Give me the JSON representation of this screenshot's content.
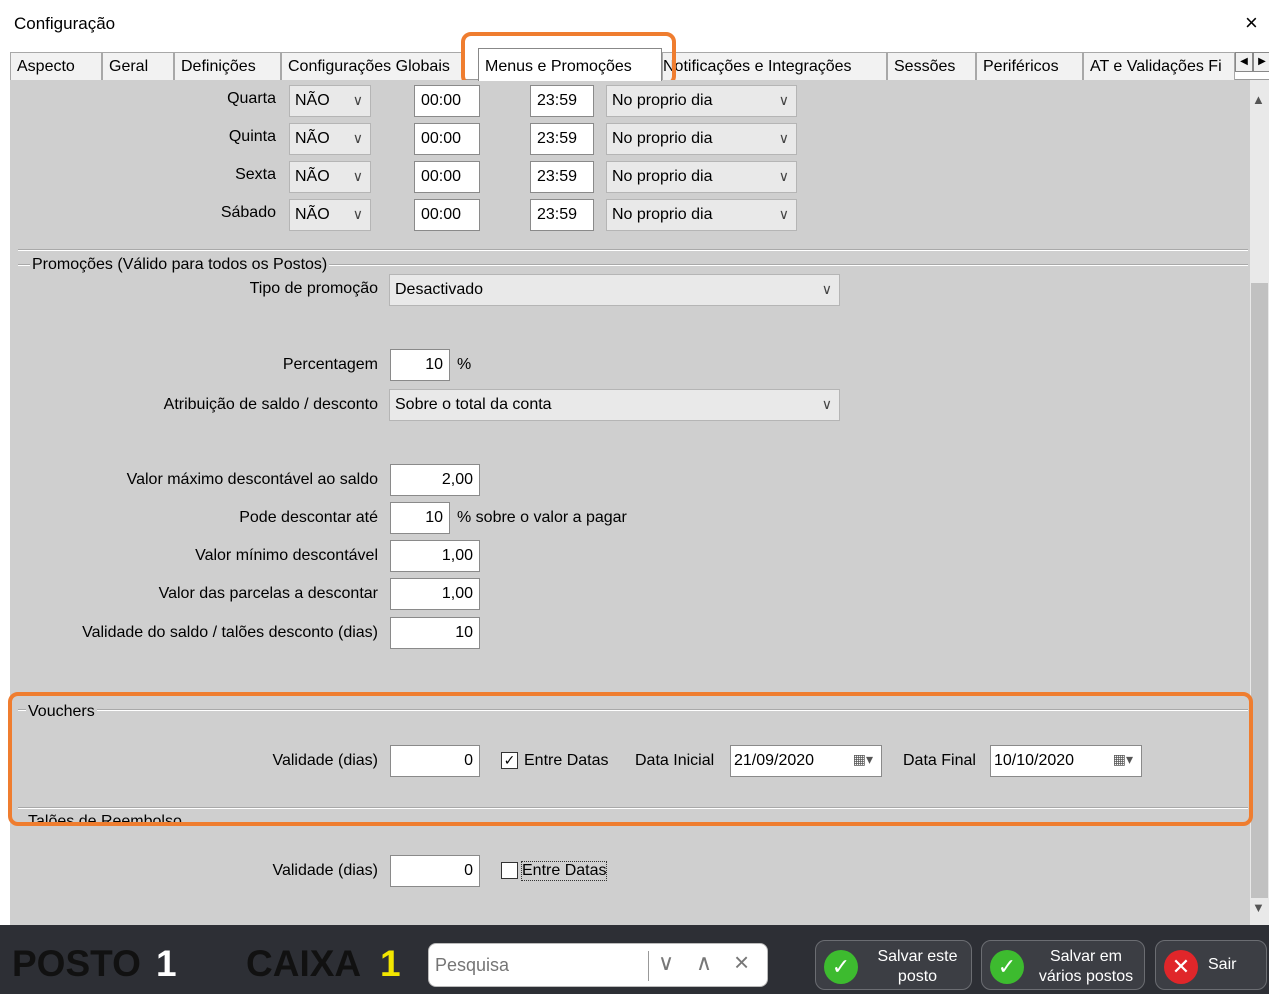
{
  "window": {
    "title": "Configuração",
    "close_glyph": "×"
  },
  "tabs": [
    {
      "label": "Aspecto"
    },
    {
      "label": "Geral"
    },
    {
      "label": "Definições"
    },
    {
      "label": "Configurações Globais"
    },
    {
      "label": "Menus e Promoções",
      "active": true
    },
    {
      "label": "Notificações e Integrações"
    },
    {
      "label": "Sessões"
    },
    {
      "label": "Periféricos"
    },
    {
      "label": "AT e Validações Fi"
    }
  ],
  "schedule": [
    {
      "day": "Quarta",
      "active": "NÃO",
      "start": "00:00",
      "end": "23:59",
      "mode": "No proprio dia"
    },
    {
      "day": "Quinta",
      "active": "NÃO",
      "start": "00:00",
      "end": "23:59",
      "mode": "No proprio dia"
    },
    {
      "day": "Sexta",
      "active": "NÃO",
      "start": "00:00",
      "end": "23:59",
      "mode": "No proprio dia"
    },
    {
      "day": "Sábado",
      "active": "NÃO",
      "start": "00:00",
      "end": "23:59",
      "mode": "No proprio dia"
    }
  ],
  "promotions": {
    "group_title": "Promoções (Válido para todos os Postos)",
    "tipo_label": "Tipo de promoção",
    "tipo_value": "Desactivado",
    "percent_label": "Percentagem",
    "percent_value": "10",
    "percent_unit": "%",
    "atribuicao_label": "Atribuição de saldo / desconto",
    "atribuicao_value": "Sobre o total da conta",
    "max_label": "Valor máximo descontável ao saldo",
    "max_value": "2,00",
    "ate_label": "Pode descontar até",
    "ate_value": "10",
    "ate_suffix": "% sobre o valor a pagar",
    "min_label": "Valor mínimo descontável",
    "min_value": "1,00",
    "parcelas_label": "Valor das parcelas a descontar",
    "parcelas_value": "1,00",
    "validade_label": "Validade do saldo / talões desconto (dias)",
    "validade_value": "10"
  },
  "vouchers": {
    "group_title": "Vouchers",
    "validade_label": "Validade (dias)",
    "validade_value": "0",
    "entre_datas_label": "Entre Datas",
    "entre_datas_checked": true,
    "data_inicial_label": "Data Inicial",
    "data_inicial_value": "21/09/2020",
    "data_final_label": "Data Final",
    "data_final_value": "10/10/2020"
  },
  "taloes": {
    "group_title": "Talões de Reembolso",
    "validade_label": "Validade (dias)",
    "validade_value": "0",
    "entre_datas_label": "Entre Datas",
    "entre_datas_checked": false
  },
  "footer": {
    "posto_label": "POSTO",
    "posto_num": "1",
    "caixa_label": "CAIXA",
    "caixa_num": "1",
    "search_placeholder": "Pesquisa",
    "save_this_l1": "Salvar este",
    "save_this_l2": "posto",
    "save_many_l1": "Salvar em",
    "save_many_l2": "vários postos",
    "exit_label": "Sair"
  },
  "colors": {
    "highlight": "#ef7d2f",
    "caixa_num": "#f2e600",
    "panel_bg": "#cfcfcf",
    "footer_bg": "#2d2f35",
    "ok_green": "#3dbb2f",
    "exit_red": "#e0262a"
  }
}
